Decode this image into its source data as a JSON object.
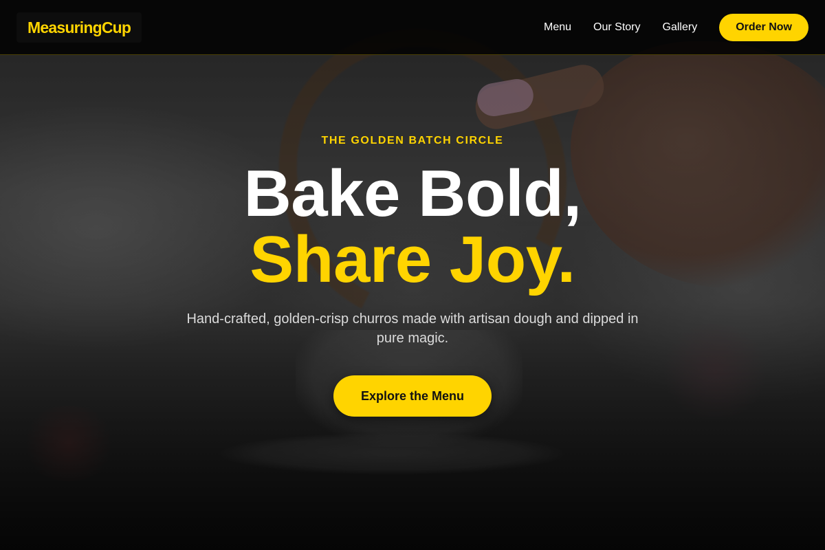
{
  "header": {
    "logo": "MeasuringCup",
    "nav": [
      {
        "label": "Menu"
      },
      {
        "label": "Our Story"
      },
      {
        "label": "Gallery"
      }
    ],
    "order_button": "Order Now"
  },
  "hero": {
    "eyebrow": "THE GOLDEN BATCH CIRCLE",
    "title_line1": "Bake Bold,",
    "title_line2": "Share Joy.",
    "subtitle": "Hand-crafted, golden-crisp churros made with artisan dough and dipped in pure magic.",
    "cta": "Explore the Menu"
  },
  "colors": {
    "accent": "#ffd400",
    "header_bg": "#000000",
    "text": "#ffffff"
  }
}
